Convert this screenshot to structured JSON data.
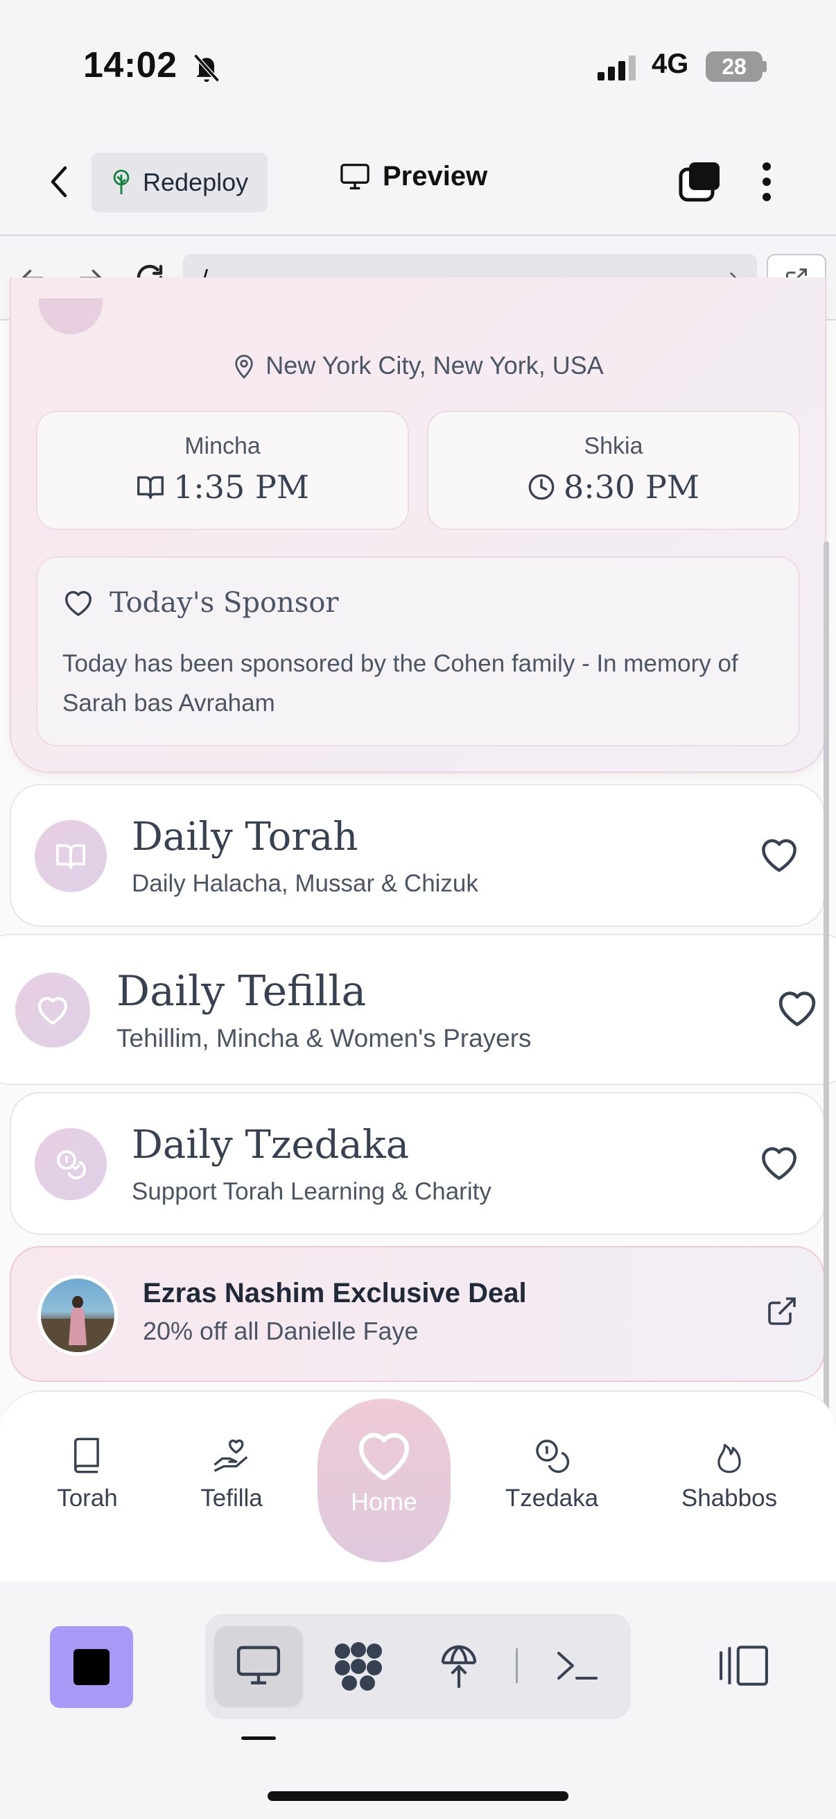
{
  "status_bar": {
    "time": "14:02",
    "network": "4G",
    "battery": "28"
  },
  "header": {
    "redeploy_label": "Redeploy",
    "preview_label": "Preview"
  },
  "url_bar": {
    "path": "/"
  },
  "location": "New York City, New York, USA",
  "times": [
    {
      "label": "Mincha",
      "value": "1:35 PM",
      "icon": "book-open-icon"
    },
    {
      "label": "Shkia",
      "value": "8:30 PM",
      "icon": "clock-icon"
    }
  ],
  "sponsor": {
    "title": "Today's Sponsor",
    "text": "Today has been sponsored by the Cohen family - In memory of Sarah bas Avraham"
  },
  "features": [
    {
      "title": "Daily Torah",
      "subtitle": "Daily Halacha, Mussar & Chizuk",
      "icon": "book-open-icon"
    },
    {
      "title": "Daily Tefilla",
      "subtitle": "Tehillim, Mincha & Women's Prayers",
      "icon": "heart-icon"
    },
    {
      "title": "Daily Tzedaka",
      "subtitle": "Support Torah Learning & Charity",
      "icon": "coins-icon"
    }
  ],
  "deal": {
    "title": "Ezras Nashim Exclusive Deal",
    "subtitle": "20% off all Danielle Faye"
  },
  "bottom_nav": {
    "items": [
      "Torah",
      "Tefilla",
      "Home",
      "Tzedaka",
      "Shabbos"
    ],
    "active": "Home"
  },
  "colors": {
    "accent": "#a99af8",
    "card_pink": "#f7e9ee",
    "icon_circle": "#e8cfe0"
  }
}
